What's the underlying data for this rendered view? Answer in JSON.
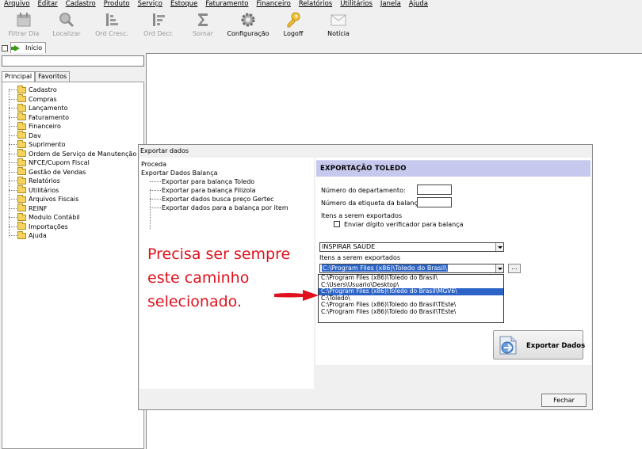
{
  "menu": [
    "Arquivo",
    "Editar",
    "Cadastro",
    "Produto",
    "Serviço",
    "Estoque",
    "Faturamento",
    "Financeiro",
    "Relatórios",
    "Utilitários",
    "Janela",
    "Ajuda"
  ],
  "toolbar": [
    {
      "label": "Filtrar Dia",
      "icon": "calendar-icon",
      "enabled": false
    },
    {
      "label": "Localizar",
      "icon": "search-icon",
      "enabled": false
    },
    {
      "label": "Ord Cresc.",
      "icon": "sort-ascending-icon",
      "enabled": false
    },
    {
      "label": "Ord Decr.",
      "icon": "sort-descending-icon",
      "enabled": false
    },
    {
      "label": "Somar",
      "icon": "sigma-icon",
      "enabled": false
    },
    {
      "label": "Configuração",
      "icon": "gear-icon",
      "enabled": true
    },
    {
      "label": "Logoff",
      "icon": "key-icon",
      "enabled": true
    },
    {
      "label": "Notícia",
      "icon": "envelope-icon",
      "enabled": true
    }
  ],
  "top_tab": "Início",
  "left_tabs": [
    "Principal",
    "Favoritos"
  ],
  "tree": [
    "Cadastro",
    "Compras",
    "Lançamento",
    "Faturamento",
    "Financeiro",
    "Dav",
    "Suprimento",
    "Ordem de Serviço de Manutenção",
    "NFCE/Cupom Fiscal",
    "Gestão de Vendas",
    "Relatórios",
    "Utilitários",
    "Arquivos Fiscais",
    "REINF",
    "Modulo Contábil",
    "Importações",
    "Ajuda"
  ],
  "dialog": {
    "title": "Exportar dados",
    "left": {
      "root1": "Proceda",
      "root2": "Exportar Dados Balança",
      "items": [
        "Exportar para balança Toledo",
        "Exportar para balança Filizola",
        "Exportar dados busca preço Gertec",
        "Exportar dados para a balança por item"
      ]
    },
    "panel": {
      "header": "EXPORTAÇÃO TOLEDO",
      "dept_label": "Número do departamento:",
      "etiq_label": "Número da etiqueta da balança:",
      "items_label": "Itens a serem exportados",
      "checkbox_label": "Enviar dígito verificador para balança",
      "combo1_value": "INSPIRAR SAUDE",
      "items_label2": "Itens a serem exportados",
      "combo2_value": "C:\\Program Files (x86)\\Toledo do Brasil\\",
      "dots_label": "...",
      "dropdown": [
        "C:\\Program Files (x86)\\Toledo do Brasil\\",
        "C:\\Users\\Usuario\\Desktop\\",
        "C:\\Program Files (x86)\\Toledo do Brasil\\MGV6\\",
        "C:\\Toledo\\",
        "C:\\Program Files (x86)\\Toledo do Brasil\\TEste\\",
        "C:\\Program Files (x86)\\Toledo do Brasil\\TEste\\"
      ],
      "highlighted_index": 2,
      "export_button": "Exportar Dados"
    },
    "close_button": "Fechar"
  },
  "annotation": {
    "lines": [
      "Precisa ser sempre",
      "este caminho",
      "selecionado."
    ],
    "color": "#e0111c"
  }
}
